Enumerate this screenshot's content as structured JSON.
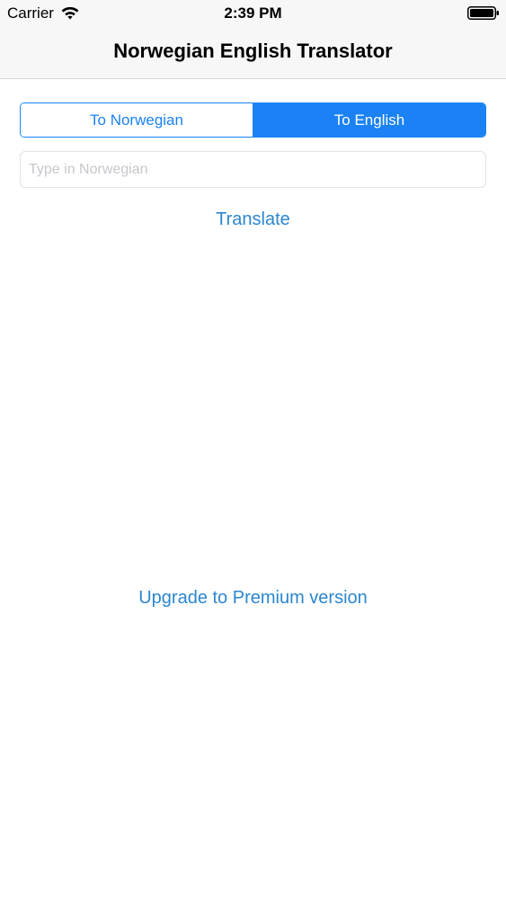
{
  "status_bar": {
    "carrier": "Carrier",
    "time": "2:39 PM",
    "wifi_icon": "wifi-icon",
    "battery_icon": "battery-icon"
  },
  "nav": {
    "title": "Norwegian English Translator"
  },
  "segments": {
    "to_norwegian": "To Norwegian",
    "to_english": "To English",
    "selected": "To English"
  },
  "input": {
    "value": "",
    "placeholder": "Type in Norwegian"
  },
  "actions": {
    "translate": "Translate",
    "upgrade": "Upgrade to Premium version"
  },
  "colors": {
    "accent": "#1a82f5",
    "link": "#2c86cf",
    "nav_background": "#f7f7f8"
  }
}
